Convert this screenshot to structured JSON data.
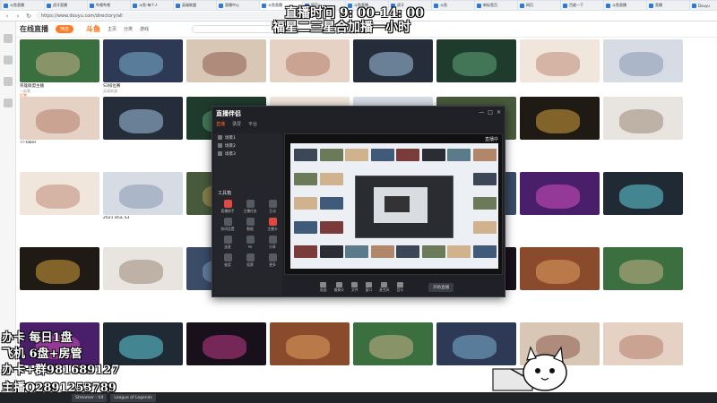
{
  "browser": {
    "tabs": [
      "斗鱼直播",
      "虎牙直播",
      "哔哩哔哩",
      "斗鱼-每个人",
      "英雄联盟",
      "直播中心",
      "斗鱼直播",
      "网页",
      "斗鱼直播",
      "虎牙",
      "斗鱼",
      "新标签页",
      "网页",
      "百度一下",
      "斗鱼直播",
      "直播",
      "Douyu"
    ],
    "url": "https://www.douyu.com/directory/all"
  },
  "site": {
    "section_title": "在线直播",
    "filter_label": "筛选",
    "head_links": [
      "主页",
      "分类",
      "游戏"
    ],
    "logo_text": "斗鱼"
  },
  "cards": [
    [
      {
        "title": "英雄联盟主播",
        "sub": "一起看",
        "badge": "打赏"
      },
      {
        "title": "S3排位赛",
        "sub": "英雄联盟",
        "badge": ""
      },
      {
        "title": "",
        "sub": "",
        "badge": ""
      },
      {
        "title": "",
        "sub": "",
        "badge": ""
      },
      {
        "title": "",
        "sub": "",
        "badge": ""
      },
      {
        "title": "",
        "sub": "",
        "badge": ""
      },
      {
        "title": "",
        "sub": "",
        "badge": ""
      },
      {
        "title": "",
        "sub": "",
        "badge": ""
      }
    ],
    [
      {
        "title": "TT-Tabel",
        "sub": "",
        "badge": ""
      },
      {
        "title": "",
        "sub": "",
        "badge": ""
      },
      {
        "title": "",
        "sub": "",
        "badge": ""
      },
      {
        "title": "",
        "sub": "",
        "badge": ""
      },
      {
        "title": "",
        "sub": "",
        "badge": ""
      },
      {
        "title": "",
        "sub": "",
        "badge": ""
      },
      {
        "title": "",
        "sub": "",
        "badge": ""
      },
      {
        "title": "",
        "sub": "",
        "badge": ""
      }
    ],
    [
      {
        "title": "",
        "sub": "",
        "badge": ""
      },
      {
        "title": "2021 DGL S3",
        "sub": "",
        "badge": ""
      },
      {
        "title": "",
        "sub": "",
        "badge": ""
      },
      {
        "title": "",
        "sub": "",
        "badge": ""
      },
      {
        "title": "",
        "sub": "",
        "badge": ""
      },
      {
        "title": "",
        "sub": "",
        "badge": ""
      },
      {
        "title": "",
        "sub": "",
        "badge": ""
      },
      {
        "title": "",
        "sub": "",
        "badge": ""
      }
    ],
    [
      {
        "title": "",
        "sub": "",
        "badge": ""
      },
      {
        "title": "",
        "sub": "",
        "badge": ""
      },
      {
        "title": "",
        "sub": "",
        "badge": ""
      },
      {
        "title": "",
        "sub": "",
        "badge": ""
      },
      {
        "title": "",
        "sub": "",
        "badge": ""
      },
      {
        "title": "",
        "sub": "",
        "badge": ""
      },
      {
        "title": "",
        "sub": "",
        "badge": ""
      },
      {
        "title": "",
        "sub": "",
        "badge": ""
      }
    ],
    [
      {
        "title": "",
        "sub": "",
        "badge": ""
      },
      {
        "title": "",
        "sub": "",
        "badge": ""
      },
      {
        "title": "",
        "sub": "",
        "badge": ""
      },
      {
        "title": "",
        "sub": "",
        "badge": ""
      },
      {
        "title": "",
        "sub": "",
        "badge": ""
      },
      {
        "title": "",
        "sub": "",
        "badge": ""
      },
      {
        "title": "",
        "sub": "",
        "badge": ""
      },
      {
        "title": "",
        "sub": "",
        "badge": ""
      }
    ]
  ],
  "app": {
    "title": "直播伴侣",
    "tabs": [
      "直播",
      "录屏",
      "平台"
    ],
    "scenes": [
      "场景1",
      "场景2",
      "场景3"
    ],
    "tools_label": "工具箱",
    "tools": [
      "直播助手",
      "主播任务",
      "互动",
      "房间设置",
      "数据",
      "主播卡",
      "连麦",
      "PK",
      "分享",
      "抽奖",
      "投票",
      "更多"
    ],
    "live_label": "直播中",
    "bottom": [
      "画面",
      "摄像头",
      "文件",
      "窗口",
      "麦克风",
      "音乐"
    ],
    "start_label": "开始直播"
  },
  "overlay": {
    "time_line": "直播时间 9: 00-14: 00",
    "sub_line": "福星二三星合加播一小时",
    "left_lines": [
      "办卡 每日1盘",
      "飞机 6盘+房管",
      "办卡+群981689127",
      "主播Q2891253789"
    ]
  },
  "taskbar": {
    "items": [
      "Streamer - V4",
      "League of Legends"
    ]
  },
  "colors": {
    "accent": "#ff7a22",
    "overlay_text": "#ffffff"
  }
}
